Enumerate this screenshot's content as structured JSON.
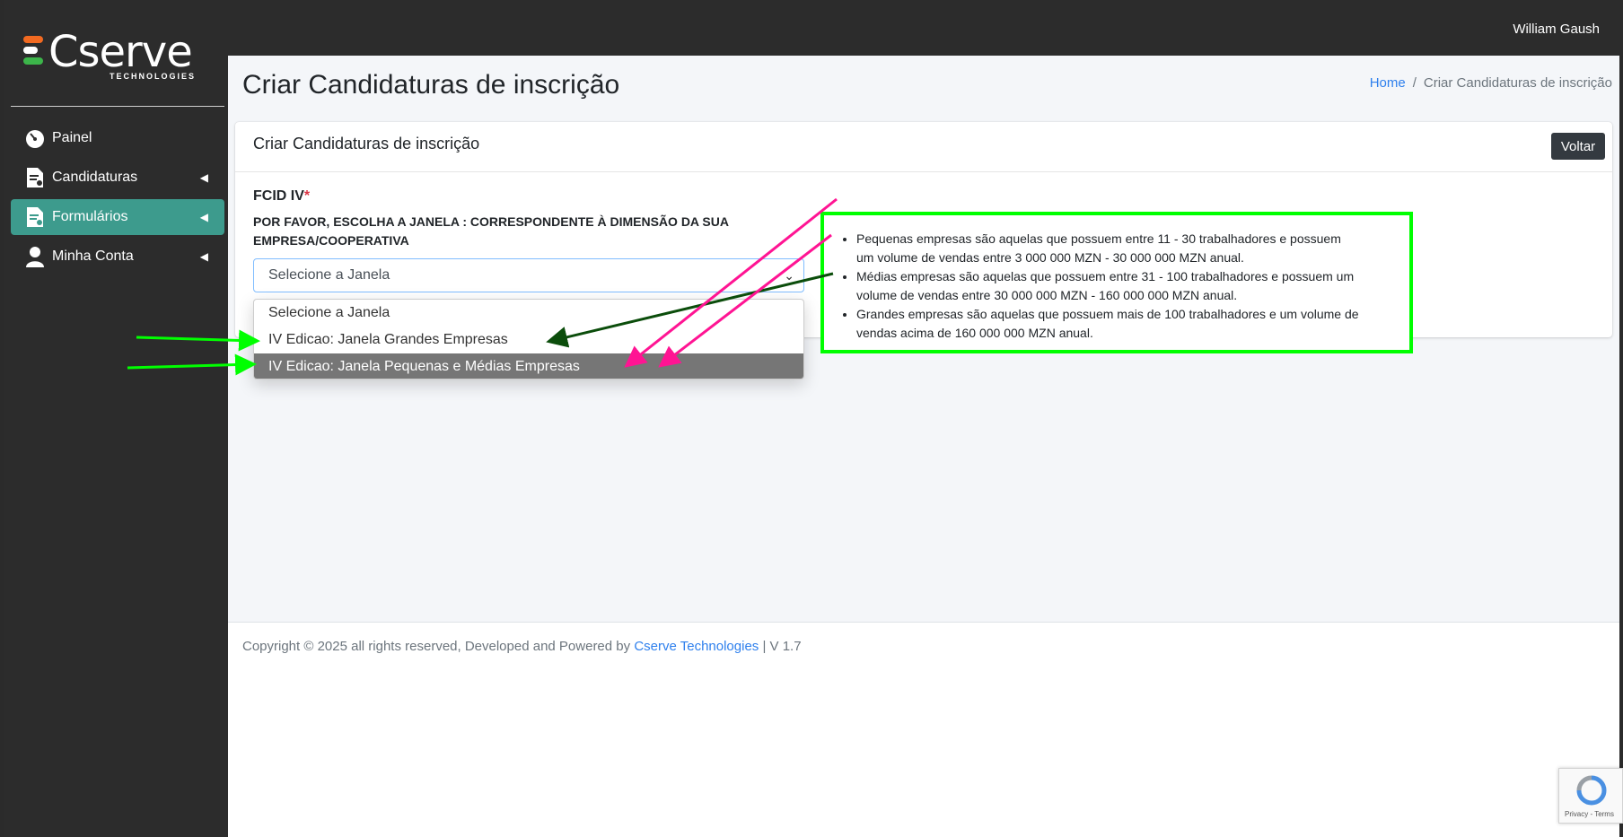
{
  "sidebar": {
    "logo": {
      "text": "Cserve",
      "subtext": "TECHNOLOGIES",
      "bar_colors": [
        "#f26a21",
        "#ffffff",
        "#3cb54a"
      ]
    },
    "items": [
      {
        "label": "Painel",
        "icon": "speedometer-icon"
      },
      {
        "label": "Candidaturas",
        "icon": "document-user-icon",
        "chevron": "chevron-left-icon"
      },
      {
        "label": "Formulários",
        "icon": "document-user-icon",
        "chevron": "chevron-left-icon",
        "active": true
      },
      {
        "label": "Minha Conta",
        "icon": "user-icon",
        "chevron": "chevron-left-icon"
      }
    ]
  },
  "header": {
    "user_name": "William Gaush"
  },
  "page": {
    "title": "Criar Candidaturas de inscrição",
    "breadcrumb": {
      "home": "Home",
      "separator": "/",
      "current": "Criar Candidaturas de inscrição"
    }
  },
  "card": {
    "title": "Criar Candidaturas de inscrição",
    "back_label": "Voltar",
    "field_label": "FCID IV",
    "required_mark": "*",
    "instruction": "POR FAVOR, ESCOLHA A JANELA : CORRESPONDENTE À DIMENSÃO DA SUA EMPRESA/COOPERATIVA",
    "select_value": "Selecione a Janela",
    "info": [
      "Pequenas empresas são aquelas que possuem entre 11 - 30 trabalhadores e possuem um volume de vendas entre 3 000 000 MZN - 30 000 000 MZN anual.",
      "Médias empresas são aquelas que possuem entre 31 - 100 trabalhadores e possuem um volume de vendas entre 30 000 000 MZN - 160 000 000 MZN anual.",
      "Grandes empresas são aquelas que possuem mais de 100 trabalhadores e um volume de vendas acima de 160 000 000 MZN anual."
    ]
  },
  "dropdown": {
    "options": [
      "Selecione a Janela",
      "IV Edicao: Janela Grandes Empresas",
      "IV Edicao: Janela Pequenas e Médias Empresas"
    ],
    "highlighted_index": 2
  },
  "footer": {
    "prefix": "Copyright © 2025 all rights reserved, Developed and Powered by",
    "brand": "Cserve Technologies",
    "version": "| V 1.7"
  },
  "recaptcha": {
    "text": "Privacy - Terms"
  },
  "colors": {
    "sidebar_bg": "#2c2c2c",
    "active_item": "#3d9b8d",
    "link": "#2f80ed",
    "annotation_green": "#00ff00",
    "annotation_pink": "#ff1493",
    "annotation_darkgreen": "#0b4d0b"
  }
}
